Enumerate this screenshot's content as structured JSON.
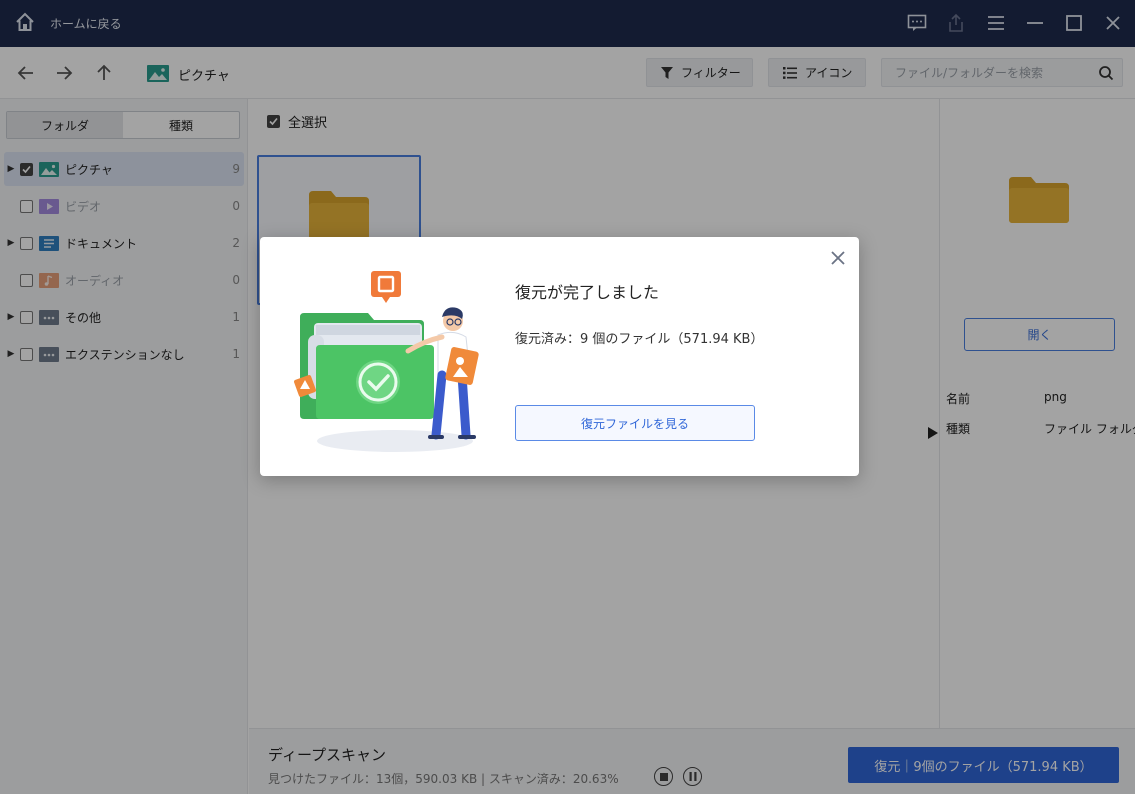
{
  "titlebar": {
    "home_text": "ホームに戻る"
  },
  "toolbar": {
    "location": "ピクチャ",
    "filter_label": "フィルター",
    "view_label": "アイコン",
    "search_placeholder": "ファイル/フォルダーを検索"
  },
  "sidebar": {
    "tab_folder": "フォルダ",
    "tab_type": "種類",
    "items": [
      {
        "label": "ピクチャ",
        "count": "9",
        "icon": "image-folder-icon"
      },
      {
        "label": "ビデオ",
        "count": "0",
        "icon": "video-folder-icon"
      },
      {
        "label": "ドキュメント",
        "count": "2",
        "icon": "document-folder-icon"
      },
      {
        "label": "オーディオ",
        "count": "0",
        "icon": "audio-folder-icon"
      },
      {
        "label": "その他",
        "count": "1",
        "icon": "other-folder-icon"
      },
      {
        "label": "エクステンションなし",
        "count": "1",
        "icon": "no-extension-folder-icon"
      }
    ]
  },
  "main": {
    "select_all": "全選択"
  },
  "details": {
    "open_label": "開く",
    "name_key": "名前",
    "name_value": "png",
    "type_key": "種類",
    "type_value": "ファイル フォルダー"
  },
  "bottom": {
    "scan_title": "ディープスキャン",
    "scan_info": "見つけたファイル：13個，590.03 KB | スキャン済み：20.63%",
    "recover_label": "復元｜9個のファイル（571.94 KB）"
  },
  "modal": {
    "title": "復元が完了しました",
    "description": "復元済み：9 個のファイル（571.94 KB）",
    "view_button": "復元ファイルを見る"
  },
  "colors": {
    "titlebar": "#1f2b4d",
    "accent": "#2f66d8",
    "folder": "#e8b53a"
  }
}
